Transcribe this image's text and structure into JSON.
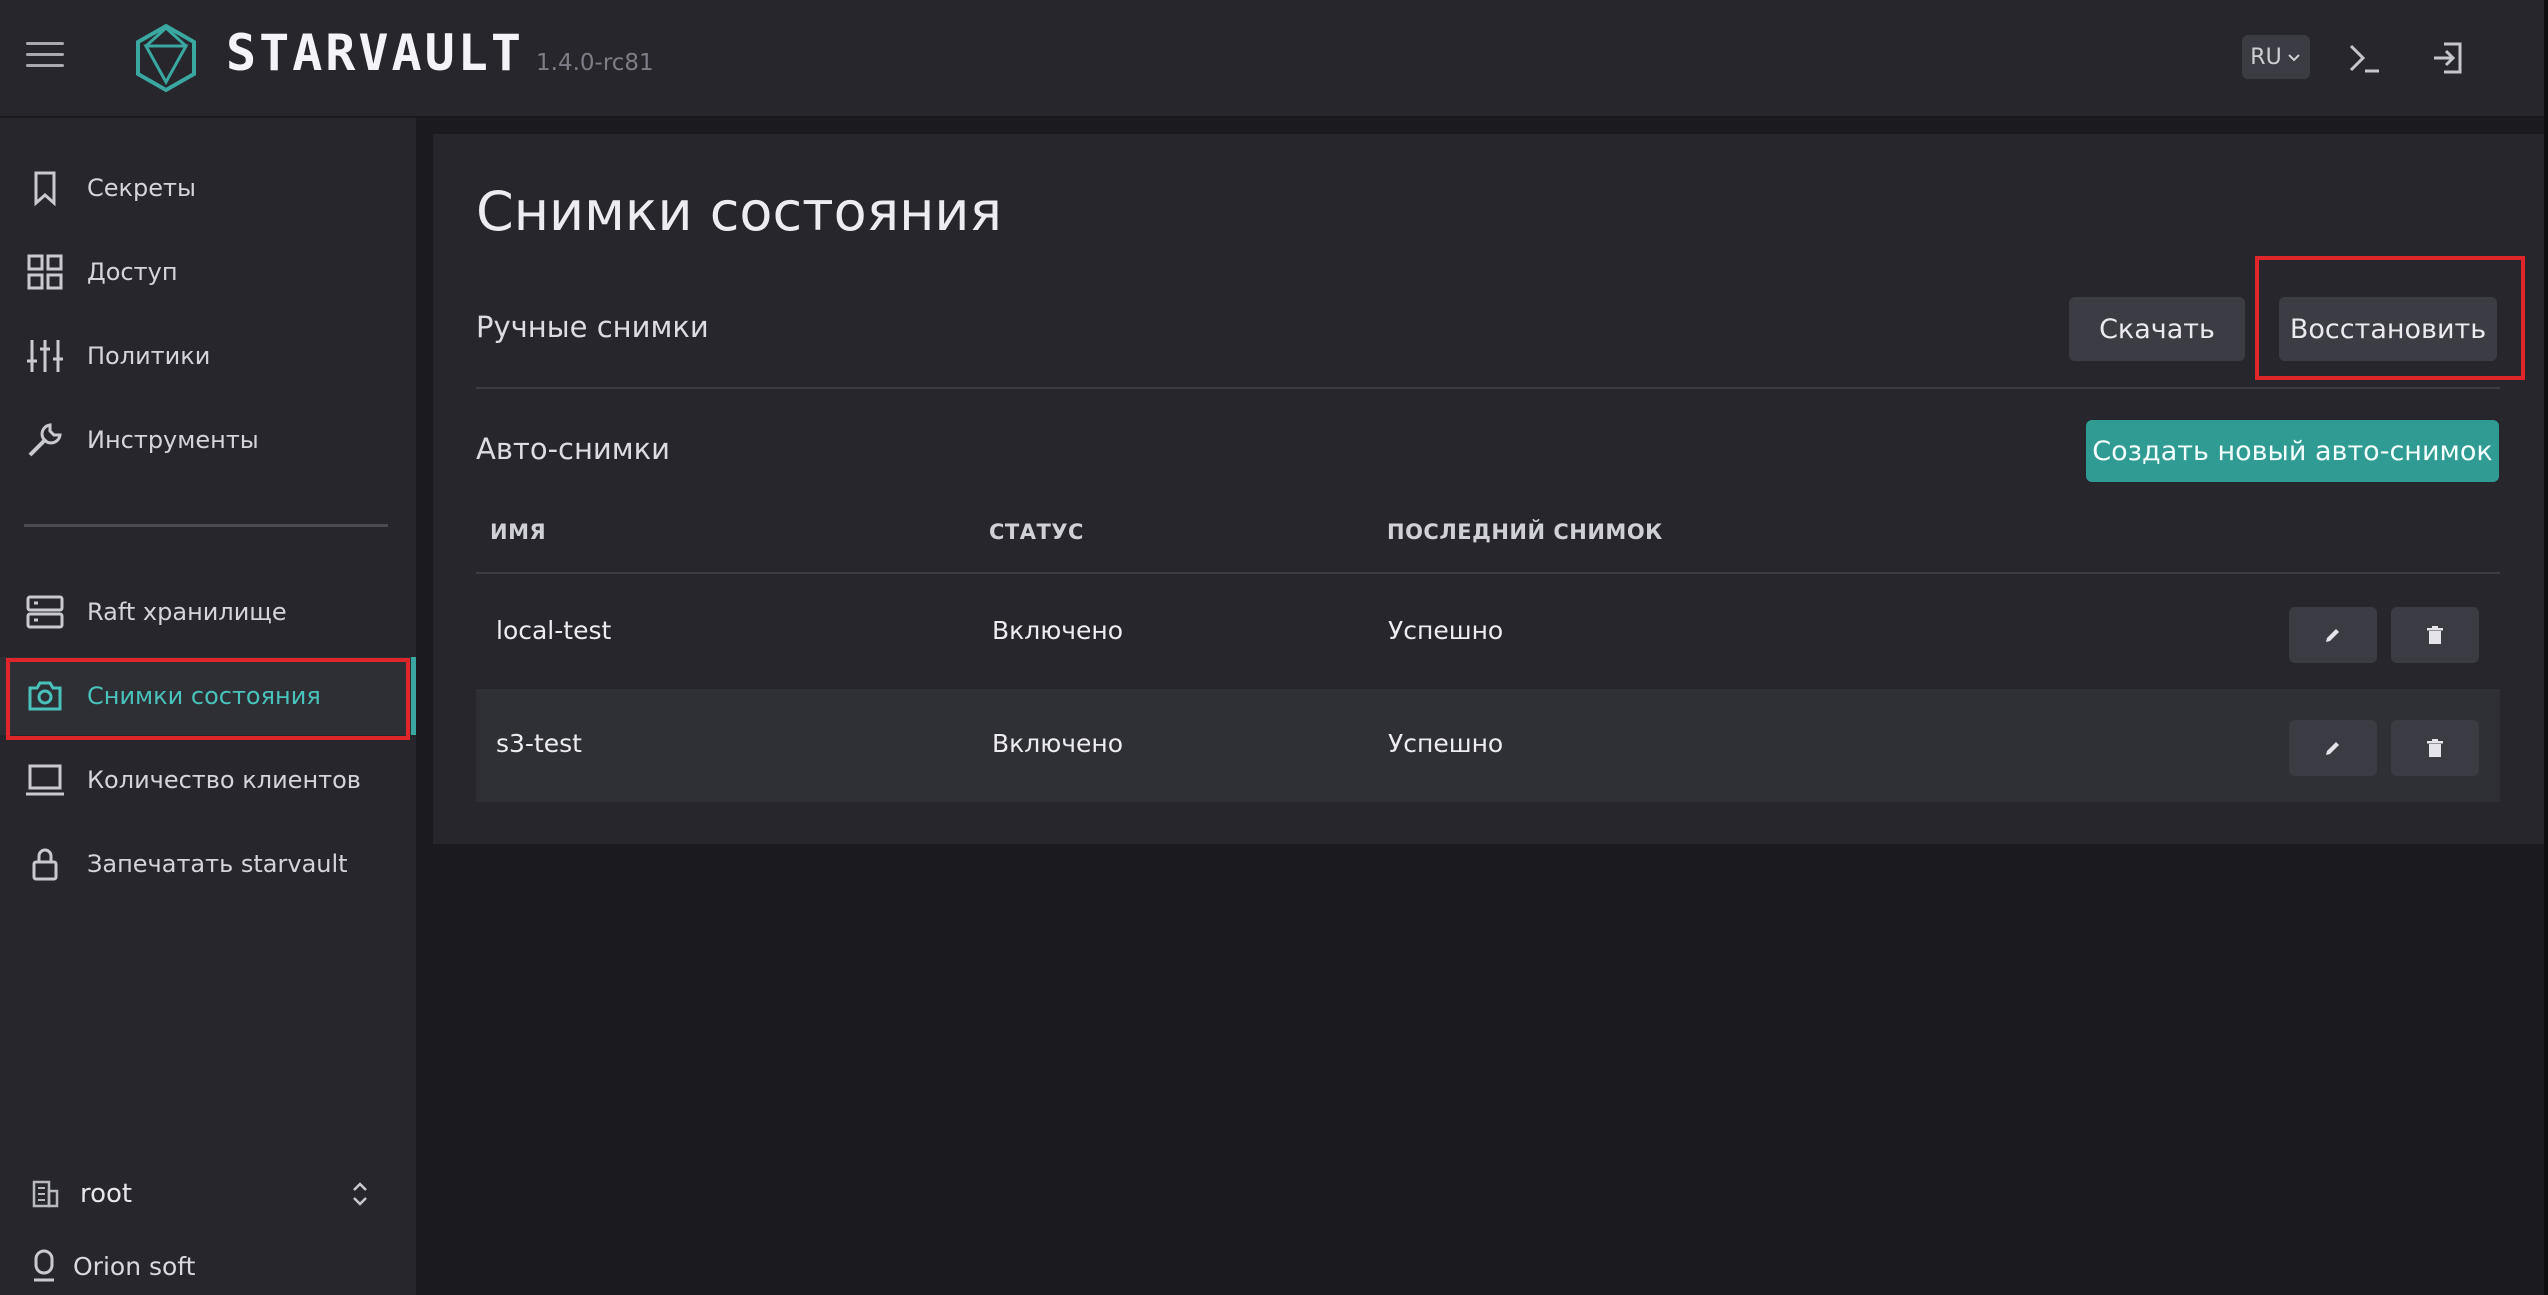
{
  "header": {
    "brand": "STARVAULT",
    "version": "1.4.0-rc81",
    "language": "RU",
    "logo_color": "#3aa8a0"
  },
  "sidebar": {
    "items": [
      {
        "label": "Секреты",
        "icon": "bookmark-icon"
      },
      {
        "label": "Доступ",
        "icon": "grid-icon"
      },
      {
        "label": "Политики",
        "icon": "sliders-icon"
      },
      {
        "label": "Инструменты",
        "icon": "wrench-icon"
      },
      {
        "label": "Raft хранилище",
        "icon": "server-icon"
      },
      {
        "label": "Снимки состояния",
        "icon": "camera-icon",
        "active": true
      },
      {
        "label": "Количество клиентов",
        "icon": "laptop-icon"
      },
      {
        "label": "Запечатать starvault",
        "icon": "lock-icon"
      }
    ],
    "namespace": "root",
    "company": "Orion soft"
  },
  "main": {
    "title": "Снимки состояния",
    "manual": {
      "title": "Ручные снимки",
      "download_label": "Скачать",
      "restore_label": "Восстановить"
    },
    "auto": {
      "title": "Авто-снимки",
      "create_label": "Создать новый авто-снимок"
    },
    "table": {
      "columns": [
        "ИМЯ",
        "СТАТУС",
        "ПОСЛЕДНИЙ СНИМОК"
      ],
      "rows": [
        {
          "name": "local-test",
          "status": "Включено",
          "last": "Успешно"
        },
        {
          "name": "s3-test",
          "status": "Включено",
          "last": "Успешно"
        }
      ]
    }
  },
  "colors": {
    "accent": "#3aa8a0",
    "highlight": "#e0262b",
    "background": "#1b1b1f",
    "surface": "#26262c"
  }
}
